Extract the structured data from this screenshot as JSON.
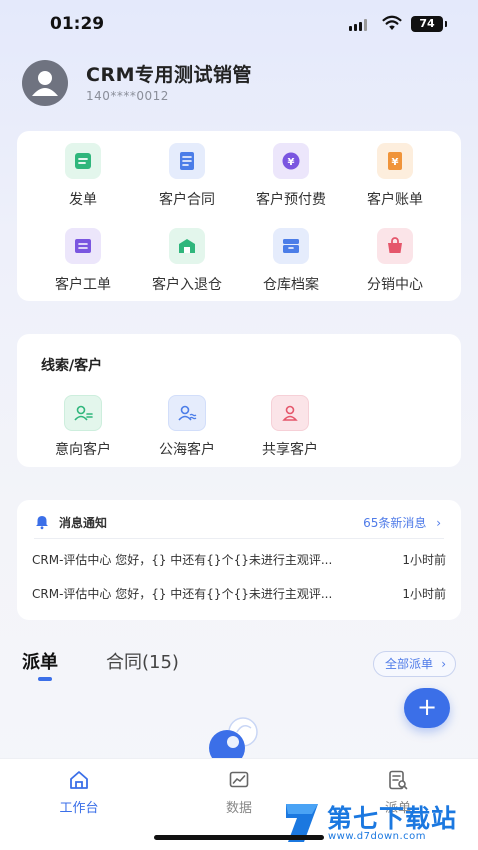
{
  "status_bar": {
    "time": "01:29",
    "battery": "74"
  },
  "profile": {
    "name": "CRM专用测试销管",
    "phone": "140****0012",
    "avatar_icon": "user-avatar-icon"
  },
  "grid": {
    "items": [
      {
        "label": "发单",
        "icon": "dispatch-icon",
        "color": "#2fb67c",
        "bg": "#e3f6ec"
      },
      {
        "label": "客户合同",
        "icon": "contract-icon",
        "color": "#4b7de8",
        "bg": "#e5ecfc"
      },
      {
        "label": "客户预付费",
        "icon": "prepaid-icon",
        "color": "#7a56e0",
        "bg": "#ece6fb"
      },
      {
        "label": "客户账单",
        "icon": "bill-icon",
        "color": "#f0943a",
        "bg": "#fdeedd"
      },
      {
        "label": "客户工单",
        "icon": "work-order-icon",
        "color": "#7a56e0",
        "bg": "#ece6fb"
      },
      {
        "label": "客户入退仓",
        "icon": "warehouse-in-out-icon",
        "color": "#2fb67c",
        "bg": "#e3f6ec"
      },
      {
        "label": "仓库档案",
        "icon": "warehouse-archive-icon",
        "color": "#4b7de8",
        "bg": "#e5ecfc"
      },
      {
        "label": "分销中心",
        "icon": "distribution-icon",
        "color": "#e5566b",
        "bg": "#fbe4e8"
      }
    ]
  },
  "leads": {
    "title": "线索/客户",
    "items": [
      {
        "label": "意向客户",
        "icon": "intent-customer-icon",
        "color": "#2fb67c",
        "bg": "#e3f6ec"
      },
      {
        "label": "公海客户",
        "icon": "public-pool-customer-icon",
        "color": "#4b7de8",
        "bg": "#e5ecfc"
      },
      {
        "label": "共享客户",
        "icon": "shared-customer-icon",
        "color": "#e5566b",
        "bg": "#fbe4e8"
      }
    ]
  },
  "notices": {
    "title": "消息通知",
    "more": "65条新消息",
    "rows": [
      {
        "text": "CRM-评估中心 您好，{} 中还有{}个{}未进行主观评...",
        "time": "1小时前"
      },
      {
        "text": "CRM-评估中心 您好，{} 中还有{}个{}未进行主观评...",
        "time": "1小时前"
      }
    ]
  },
  "tabs": {
    "active": "派单",
    "inactive": "合同(15)",
    "all_button": "全部派单"
  },
  "fab": {
    "label": "+"
  },
  "bottom_nav": {
    "items": [
      {
        "label": "工作台",
        "icon": "home-icon",
        "active": true
      },
      {
        "label": "数据",
        "icon": "chart-icon",
        "active": false
      },
      {
        "label": "派单",
        "icon": "dispatch-list-icon",
        "active": false
      }
    ]
  },
  "watermark": {
    "name": "第七下载站",
    "url": "www.d7down.com"
  },
  "colors": {
    "accent": "#3b6fe8",
    "link": "#4f7be8"
  }
}
